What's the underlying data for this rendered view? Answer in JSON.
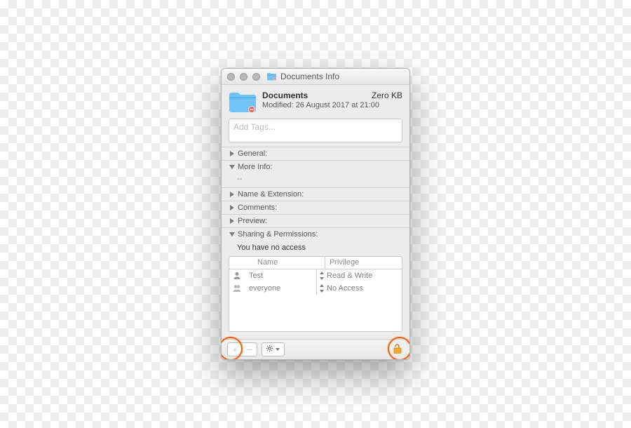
{
  "title": "Documents Info",
  "header": {
    "name": "Documents",
    "size": "Zero KB",
    "modified": "Modified: 26 August 2017 at 21:00"
  },
  "tags": {
    "placeholder": "Add Tags..."
  },
  "sections": {
    "general": "General:",
    "more_info": "More Info:",
    "more_info_body": "--",
    "name_ext": "Name & Extension:",
    "comments": "Comments:",
    "preview": "Preview:",
    "sharing": "Sharing & Permissions:"
  },
  "sharing": {
    "message": "You have no access",
    "columns": {
      "name": "Name",
      "privilege": "Privilege"
    },
    "rows": [
      {
        "user": "Test",
        "privilege": "Read & Write",
        "icon": "user"
      },
      {
        "user": "everyone",
        "privilege": "No Access",
        "icon": "group"
      }
    ]
  },
  "footer": {
    "add": "+",
    "remove": "−"
  }
}
